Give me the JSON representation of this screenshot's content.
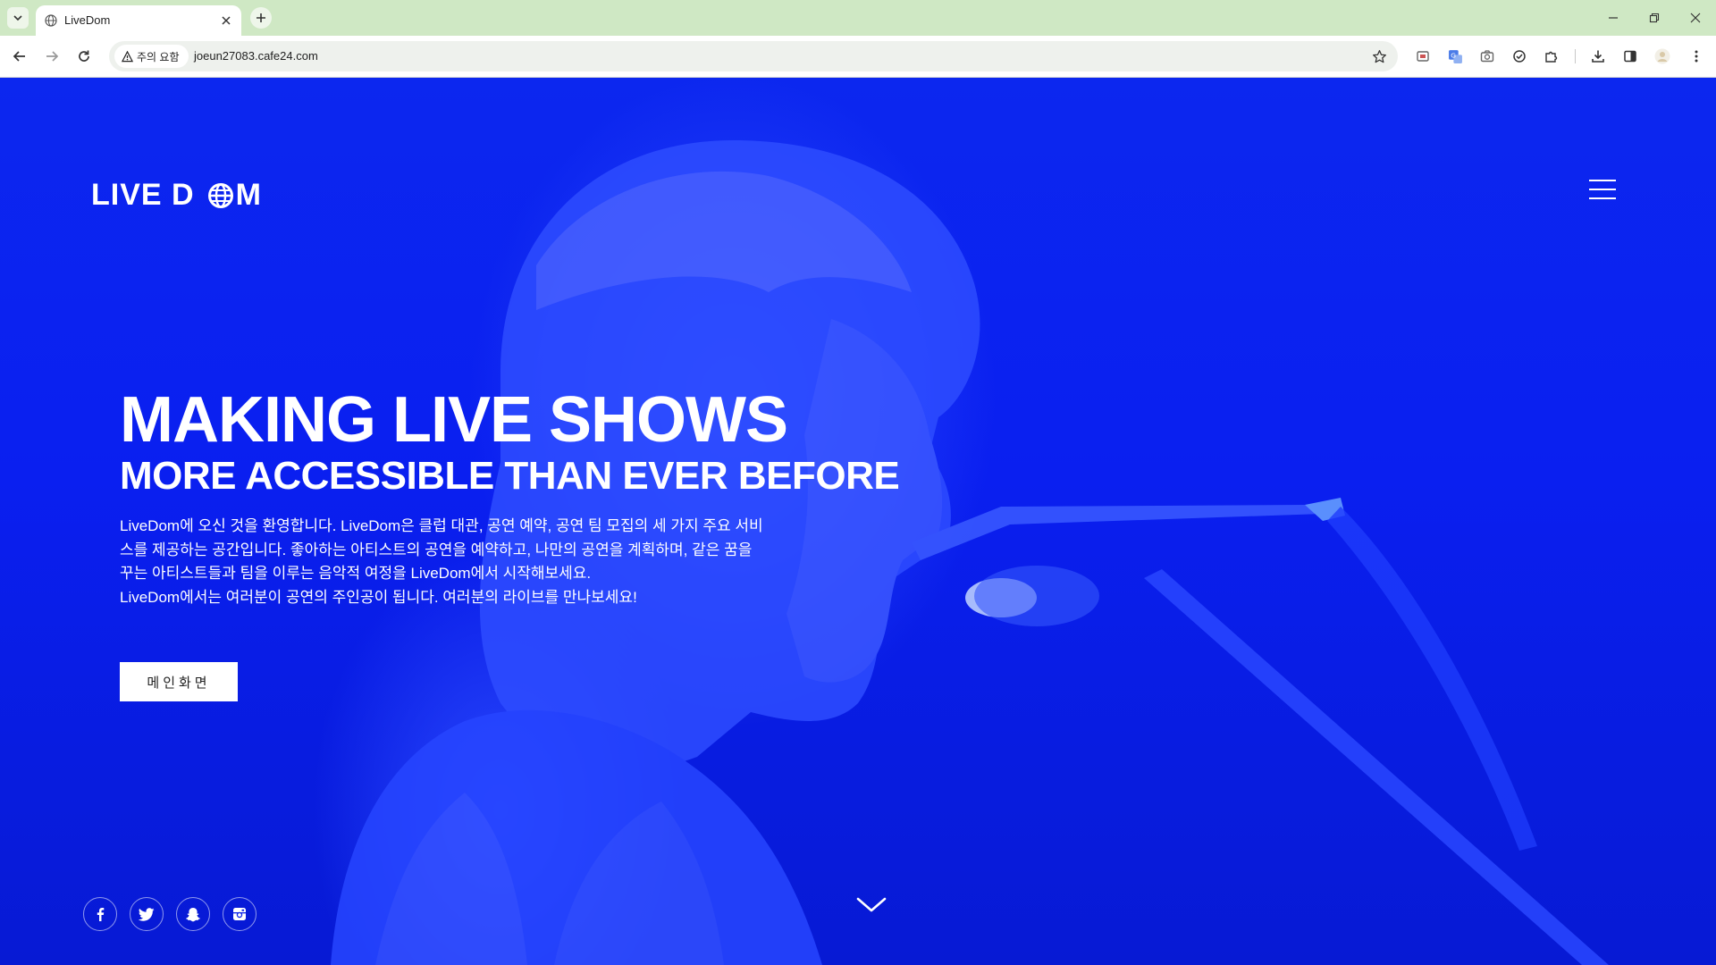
{
  "browser": {
    "tab_title": "LiveDom",
    "security_chip": "주의 요함",
    "url": "joeun27083.cafe24.com"
  },
  "page": {
    "logo_part1": "LIVE D",
    "logo_part2": "M",
    "headline": "MAKING LIVE SHOWS",
    "subheadline": "MORE ACCESSIBLE THAN EVER BEFORE",
    "intro_p1": "LiveDom에 오신 것을 환영합니다. LiveDom은 클럽 대관, 공연 예약, 공연 팀 모집의 세 가지 주요 서비스를 제공하는 공간입니다. 좋아하는 아티스트의 공연을 예약하고, 나만의 공연을 계획하며, 같은 꿈을 꾸는 아티스트들과 팀을 이루는 음악적 여정을 LiveDom에서 시작해보세요.",
    "intro_p2": "LiveDom에서는 여러분이 공연의 주인공이 됩니다. 여러분의 라이브를 만나보세요!",
    "main_button": "메인화면",
    "social_icons": [
      "facebook-icon",
      "twitter-icon",
      "snapchat-icon",
      "instagram-icon"
    ]
  },
  "colors": {
    "hero_blue": "#0a22e8",
    "tabbar": "#cfe8c4",
    "text_white": "#ffffff"
  }
}
